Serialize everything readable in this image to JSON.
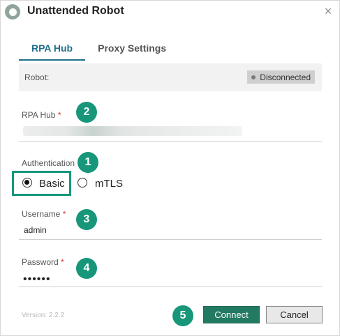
{
  "window": {
    "title": "Unattended Robot",
    "close_icon": "×"
  },
  "tabs": [
    {
      "label": "RPA Hub",
      "active": true
    },
    {
      "label": "Proxy Settings",
      "active": false
    }
  ],
  "robot": {
    "label": "Robot:",
    "status": "Disconnected"
  },
  "rpa_hub": {
    "label": "RPA Hub",
    "required_mark": "*"
  },
  "authentication": {
    "label": "Authentication",
    "options": [
      {
        "label": "Basic",
        "selected": true
      },
      {
        "label": "mTLS",
        "selected": false
      }
    ]
  },
  "username": {
    "label": "Username",
    "required_mark": "*",
    "value": "admin"
  },
  "password": {
    "label": "Password",
    "required_mark": "*",
    "value": "••••••"
  },
  "version": "Version: 2.2.2",
  "buttons": {
    "connect": "Connect",
    "cancel": "Cancel"
  },
  "badges": [
    "1",
    "2",
    "3",
    "4",
    "5"
  ],
  "colors": {
    "accent": "#17967a",
    "tab_active": "#1f6f8b",
    "connect_bg": "#237a63",
    "required": "#d9332b"
  }
}
